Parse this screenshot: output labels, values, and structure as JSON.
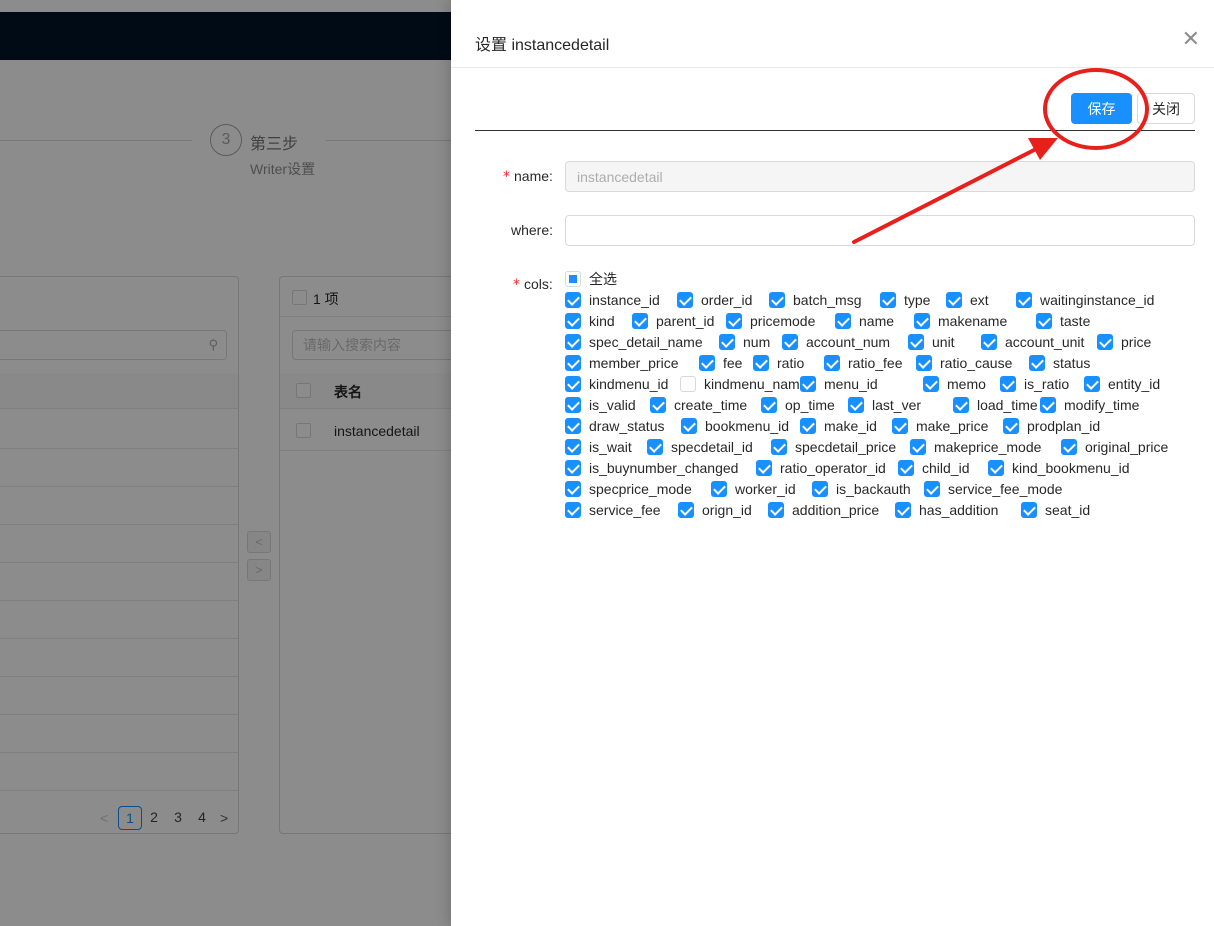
{
  "background": {
    "steps": {
      "number": "3",
      "title": "第三步",
      "desc": "Writer设置"
    },
    "right_panel": {
      "count_label": "1 项",
      "search_placeholder": "请输入搜索内容",
      "column_header": "表名",
      "rows": [
        "instancedetail"
      ]
    },
    "pagination": {
      "prev": "<",
      "pages": [
        "1",
        "2",
        "3",
        "4"
      ],
      "active": "1",
      "next": ">"
    },
    "transfer_ops": [
      "<",
      ">"
    ]
  },
  "drawer": {
    "title": "设置 instancedetail",
    "close_icon": "close-icon",
    "save_label": "保存",
    "close_label": "关闭",
    "name_label": "name",
    "name_value": "instancedetail",
    "where_label": "where",
    "where_value": "",
    "cols_label": "cols",
    "select_all_label": "全选",
    "select_all_state": "indeterminate",
    "cols": [
      [
        {
          "label": "instance_id",
          "checked": true
        },
        {
          "label": "order_id",
          "checked": true
        },
        {
          "label": "batch_msg",
          "checked": true
        },
        {
          "label": "type",
          "checked": true
        },
        {
          "label": "ext",
          "checked": true
        },
        {
          "label": "waitinginstance_id",
          "checked": true
        }
      ],
      [
        {
          "label": "kind",
          "checked": true
        },
        {
          "label": "parent_id",
          "checked": true
        },
        {
          "label": "pricemode",
          "checked": true
        },
        {
          "label": "name",
          "checked": true
        },
        {
          "label": "makename",
          "checked": true
        },
        {
          "label": "taste",
          "checked": true
        }
      ],
      [
        {
          "label": "spec_detail_name",
          "checked": true
        },
        {
          "label": "num",
          "checked": true
        },
        {
          "label": "account_num",
          "checked": true
        },
        {
          "label": "unit",
          "checked": true
        },
        {
          "label": "account_unit",
          "checked": true
        },
        {
          "label": "price",
          "checked": true
        }
      ],
      [
        {
          "label": "member_price",
          "checked": true
        },
        {
          "label": "fee",
          "checked": true
        },
        {
          "label": "ratio",
          "checked": true
        },
        {
          "label": "ratio_fee",
          "checked": true
        },
        {
          "label": "ratio_cause",
          "checked": true
        },
        {
          "label": "status",
          "checked": true
        }
      ],
      [
        {
          "label": "kindmenu_id",
          "checked": true
        },
        {
          "label": "kindmenu_name",
          "checked": false
        },
        {
          "label": "menu_id",
          "checked": true
        },
        {
          "label": "memo",
          "checked": true
        },
        {
          "label": "is_ratio",
          "checked": true
        },
        {
          "label": "entity_id",
          "checked": true
        }
      ],
      [
        {
          "label": "is_valid",
          "checked": true
        },
        {
          "label": "create_time",
          "checked": true
        },
        {
          "label": "op_time",
          "checked": true
        },
        {
          "label": "last_ver",
          "checked": true
        },
        {
          "label": "load_time",
          "checked": true
        },
        {
          "label": "modify_time",
          "checked": true
        }
      ],
      [
        {
          "label": "draw_status",
          "checked": true
        },
        {
          "label": "bookmenu_id",
          "checked": true
        },
        {
          "label": "make_id",
          "checked": true
        },
        {
          "label": "make_price",
          "checked": true
        },
        {
          "label": "prodplan_id",
          "checked": true
        }
      ],
      [
        {
          "label": "is_wait",
          "checked": true
        },
        {
          "label": "specdetail_id",
          "checked": true
        },
        {
          "label": "specdetail_price",
          "checked": true
        },
        {
          "label": "makeprice_mode",
          "checked": true
        },
        {
          "label": "original_price",
          "checked": true
        }
      ],
      [
        {
          "label": "is_buynumber_changed",
          "checked": true
        },
        {
          "label": "ratio_operator_id",
          "checked": true
        },
        {
          "label": "child_id",
          "checked": true
        },
        {
          "label": "kind_bookmenu_id",
          "checked": true
        }
      ],
      [
        {
          "label": "specprice_mode",
          "checked": true
        },
        {
          "label": "worker_id",
          "checked": true
        },
        {
          "label": "is_backauth",
          "checked": true
        },
        {
          "label": "service_fee_mode",
          "checked": true
        }
      ],
      [
        {
          "label": "service_fee",
          "checked": true
        },
        {
          "label": "orign_id",
          "checked": true
        },
        {
          "label": "addition_price",
          "checked": true
        },
        {
          "label": "has_addition",
          "checked": true
        },
        {
          "label": "seat_id",
          "checked": true
        }
      ]
    ]
  },
  "annotation": {
    "color": "#e8201c",
    "shape": "ellipse-around-save-with-arrow"
  }
}
